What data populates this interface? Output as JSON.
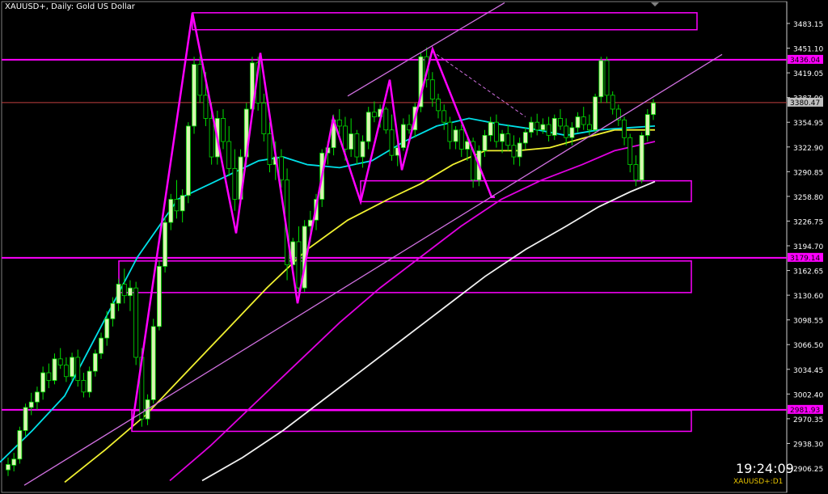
{
  "title": "XAUUSD+, Daily:  Gold US Dollar",
  "clock": "19:24:09",
  "symbol_tf": "XAUUSD+:D1",
  "colors": {
    "background": "#000000",
    "axis": "#ffffff",
    "bull_candle": "#d9f5b2",
    "bear_candle": "#000000",
    "wick": "#00e000",
    "magenta": "#ff00ff",
    "light_magenta": "#d070e0",
    "price_line": "#c04040",
    "ma_cyan": "#00e0e8",
    "ma_yellow": "#f0f030",
    "ma_magenta": "#e000e0",
    "ma_white": "#f0f0f0",
    "label_magenta_bg": "#ff00ff",
    "label_price_bg": "#c0c0c0"
  },
  "chart_data": {
    "type": "candlestick",
    "y_range": [
      2890,
      3500
    ],
    "y_ticks": [
      "3483.15",
      "3451.10",
      "3419.05",
      "3387.00",
      "3354.95",
      "3322.90",
      "3290.85",
      "3258.80",
      "3226.75",
      "3194.70",
      "3162.65",
      "3130.60",
      "3098.55",
      "3066.50",
      "3034.45",
      "3002.40",
      "2970.35",
      "2938.30",
      "2906.25"
    ],
    "price_labels": [
      {
        "text": "3436.04",
        "value": 3436.04,
        "style": "magenta"
      },
      {
        "text": "3380.47",
        "value": 3380.47,
        "style": "price"
      },
      {
        "text": "3179.14",
        "value": 3179.14,
        "style": "magenta"
      },
      {
        "text": "2981.93",
        "value": 2981.93,
        "style": "magenta"
      }
    ],
    "horizontal_lines": [
      {
        "value": 3436.04,
        "color": "magenta"
      },
      {
        "value": 3380.47,
        "color": "price"
      },
      {
        "value": 3179.14,
        "color": "magenta"
      },
      {
        "value": 2981.93,
        "color": "magenta"
      }
    ],
    "candles": [
      [
        2904,
        2920,
        2896,
        2911
      ],
      [
        2910,
        2926,
        2902,
        2918
      ],
      [
        2918,
        2960,
        2912,
        2955
      ],
      [
        2955,
        2990,
        2948,
        2985
      ],
      [
        2985,
        3004,
        2975,
        2992
      ],
      [
        2992,
        3012,
        2982,
        3005
      ],
      [
        3005,
        3038,
        2995,
        3030
      ],
      [
        3030,
        3042,
        3010,
        3020
      ],
      [
        3020,
        3055,
        3015,
        3048
      ],
      [
        3048,
        3062,
        3035,
        3040
      ],
      [
        3040,
        3050,
        3018,
        3025
      ],
      [
        3025,
        3056,
        3020,
        3050
      ],
      [
        3050,
        3060,
        3012,
        3020
      ],
      [
        3020,
        3030,
        2998,
        3005
      ],
      [
        3005,
        3038,
        2998,
        3032
      ],
      [
        3032,
        3060,
        3025,
        3055
      ],
      [
        3055,
        3082,
        3048,
        3075
      ],
      [
        3075,
        3110,
        3065,
        3100
      ],
      [
        3100,
        3128,
        3090,
        3120
      ],
      [
        3120,
        3152,
        3110,
        3145
      ],
      [
        3145,
        3165,
        3120,
        3130
      ],
      [
        3130,
        3150,
        3110,
        3140
      ],
      [
        3140,
        3148,
        3040,
        3050
      ],
      [
        3050,
        3062,
        2960,
        2970
      ],
      [
        2970,
        3002,
        2962,
        2995
      ],
      [
        2995,
        3100,
        2990,
        3090
      ],
      [
        3090,
        3175,
        3085,
        3168
      ],
      [
        3168,
        3232,
        3160,
        3225
      ],
      [
        3225,
        3262,
        3215,
        3255
      ],
      [
        3255,
        3280,
        3230,
        3240
      ],
      [
        3240,
        3268,
        3225,
        3260
      ],
      [
        3260,
        3355,
        3250,
        3350
      ],
      [
        3350,
        3440,
        3340,
        3430
      ],
      [
        3430,
        3440,
        3380,
        3390
      ],
      [
        3390,
        3420,
        3350,
        3360
      ],
      [
        3360,
        3380,
        3300,
        3310
      ],
      [
        3310,
        3370,
        3300,
        3360
      ],
      [
        3360,
        3372,
        3320,
        3330
      ],
      [
        3330,
        3350,
        3285,
        3295
      ],
      [
        3295,
        3320,
        3240,
        3255
      ],
      [
        3255,
        3320,
        3248,
        3310
      ],
      [
        3310,
        3380,
        3300,
        3372
      ],
      [
        3372,
        3440,
        3365,
        3432
      ],
      [
        3432,
        3440,
        3370,
        3380
      ],
      [
        3380,
        3392,
        3330,
        3340
      ],
      [
        3340,
        3355,
        3290,
        3300
      ],
      [
        3300,
        3330,
        3280,
        3310
      ],
      [
        3310,
        3320,
        3270,
        3280
      ],
      [
        3280,
        3295,
        3150,
        3170
      ],
      [
        3170,
        3205,
        3160,
        3200
      ],
      [
        3200,
        3220,
        3130,
        3140
      ],
      [
        3140,
        3228,
        3135,
        3220
      ],
      [
        3220,
        3240,
        3200,
        3228
      ],
      [
        3228,
        3262,
        3215,
        3255
      ],
      [
        3255,
        3320,
        3245,
        3315
      ],
      [
        3315,
        3330,
        3300,
        3322
      ],
      [
        3322,
        3365,
        3312,
        3358
      ],
      [
        3358,
        3372,
        3340,
        3350
      ],
      [
        3350,
        3362,
        3305,
        3320
      ],
      [
        3320,
        3360,
        3310,
        3340
      ],
      [
        3340,
        3345,
        3300,
        3310
      ],
      [
        3310,
        3338,
        3296,
        3330
      ],
      [
        3330,
        3375,
        3320,
        3368
      ],
      [
        3368,
        3382,
        3355,
        3362
      ],
      [
        3362,
        3378,
        3348,
        3372
      ],
      [
        3372,
        3375,
        3340,
        3345
      ],
      [
        3345,
        3365,
        3305,
        3312
      ],
      [
        3312,
        3330,
        3298,
        3322
      ],
      [
        3322,
        3360,
        3318,
        3352
      ],
      [
        3352,
        3365,
        3340,
        3345
      ],
      [
        3345,
        3380,
        3335,
        3375
      ],
      [
        3375,
        3445,
        3368,
        3440
      ],
      [
        3440,
        3452,
        3400,
        3410
      ],
      [
        3410,
        3420,
        3375,
        3385
      ],
      [
        3385,
        3392,
        3360,
        3370
      ],
      [
        3370,
        3378,
        3345,
        3355
      ],
      [
        3355,
        3362,
        3320,
        3330
      ],
      [
        3330,
        3350,
        3320,
        3345
      ],
      [
        3345,
        3352,
        3310,
        3320
      ],
      [
        3320,
        3338,
        3305,
        3330
      ],
      [
        3330,
        3335,
        3270,
        3280
      ],
      [
        3280,
        3325,
        3272,
        3318
      ],
      [
        3318,
        3345,
        3310,
        3338
      ],
      [
        3338,
        3362,
        3330,
        3355
      ],
      [
        3355,
        3365,
        3322,
        3330
      ],
      [
        3330,
        3345,
        3315,
        3340
      ],
      [
        3340,
        3352,
        3318,
        3325
      ],
      [
        3325,
        3338,
        3300,
        3310
      ],
      [
        3310,
        3335,
        3298,
        3328
      ],
      [
        3328,
        3348,
        3320,
        3342
      ],
      [
        3342,
        3362,
        3335,
        3355
      ],
      [
        3355,
        3366,
        3338,
        3345
      ],
      [
        3345,
        3360,
        3340,
        3352
      ],
      [
        3352,
        3362,
        3330,
        3338
      ],
      [
        3338,
        3365,
        3332,
        3360
      ],
      [
        3360,
        3372,
        3345,
        3350
      ],
      [
        3350,
        3360,
        3325,
        3335
      ],
      [
        3335,
        3355,
        3325,
        3348
      ],
      [
        3348,
        3368,
        3342,
        3362
      ],
      [
        3362,
        3375,
        3345,
        3352
      ],
      [
        3352,
        3365,
        3338,
        3345
      ],
      [
        3345,
        3392,
        3340,
        3388
      ],
      [
        3388,
        3440,
        3380,
        3435
      ],
      [
        3435,
        3440,
        3380,
        3390
      ],
      [
        3390,
        3395,
        3365,
        3372
      ],
      [
        3372,
        3378,
        3350,
        3358
      ],
      [
        3358,
        3362,
        3325,
        3335
      ],
      [
        3335,
        3340,
        3290,
        3300
      ],
      [
        3300,
        3312,
        3272,
        3280
      ],
      [
        3280,
        3342,
        3276,
        3338
      ],
      [
        3338,
        3372,
        3330,
        3365
      ],
      [
        3365,
        3385,
        3358,
        3380
      ]
    ],
    "ma_cyan": [
      [
        0,
        2914
      ],
      [
        40,
        2955
      ],
      [
        80,
        3000
      ],
      [
        120,
        3080
      ],
      [
        170,
        3180
      ],
      [
        220,
        3255
      ],
      [
        260,
        3275
      ],
      [
        290,
        3290
      ],
      [
        320,
        3305
      ],
      [
        350,
        3310
      ],
      [
        380,
        3300
      ],
      [
        420,
        3296
      ],
      [
        460,
        3305
      ],
      [
        500,
        3330
      ],
      [
        540,
        3350
      ],
      [
        580,
        3360
      ],
      [
        620,
        3352
      ],
      [
        660,
        3346
      ],
      [
        700,
        3338
      ],
      [
        740,
        3345
      ],
      [
        780,
        3348
      ],
      [
        810,
        3350
      ]
    ],
    "ma_yellow": [
      [
        80,
        2888
      ],
      [
        130,
        2930
      ],
      [
        180,
        2975
      ],
      [
        230,
        3030
      ],
      [
        280,
        3085
      ],
      [
        330,
        3140
      ],
      [
        380,
        3190
      ],
      [
        430,
        3228
      ],
      [
        480,
        3255
      ],
      [
        520,
        3275
      ],
      [
        560,
        3300
      ],
      [
        600,
        3318
      ],
      [
        640,
        3318
      ],
      [
        680,
        3322
      ],
      [
        720,
        3334
      ],
      [
        760,
        3345
      ],
      [
        810,
        3345
      ]
    ],
    "ma_magenta": [
      [
        210,
        2890
      ],
      [
        260,
        2935
      ],
      [
        320,
        2995
      ],
      [
        370,
        3045
      ],
      [
        420,
        3095
      ],
      [
        470,
        3140
      ],
      [
        520,
        3180
      ],
      [
        570,
        3220
      ],
      [
        620,
        3255
      ],
      [
        670,
        3280
      ],
      [
        720,
        3300
      ],
      [
        760,
        3318
      ],
      [
        810,
        3330
      ]
    ],
    "ma_white": [
      [
        250,
        2890
      ],
      [
        300,
        2920
      ],
      [
        350,
        2955
      ],
      [
        400,
        2995
      ],
      [
        450,
        3035
      ],
      [
        500,
        3075
      ],
      [
        550,
        3115
      ],
      [
        600,
        3155
      ],
      [
        650,
        3190
      ],
      [
        700,
        3220
      ],
      [
        740,
        3245
      ],
      [
        780,
        3265
      ],
      [
        810,
        3278
      ]
    ],
    "zigzag": [
      [
        163,
        2958
      ],
      [
        238,
        3497
      ],
      [
        292,
        3211
      ],
      [
        322,
        3445
      ],
      [
        368,
        3120
      ],
      [
        412,
        3360
      ],
      [
        446,
        3252
      ],
      [
        482,
        3410
      ],
      [
        497,
        3293
      ],
      [
        535,
        3450
      ],
      [
        608,
        3258
      ],
      [
        612,
        3258
      ]
    ],
    "channel": [
      {
        "from": [
          30,
          2884
        ],
        "to": [
          893,
          3443
        ],
        "color": "light_magenta"
      },
      {
        "from": [
          430,
          3389
        ],
        "to": [
          624,
          3510
        ],
        "color": "light_magenta"
      }
    ],
    "dashed_line": {
      "from": [
        540,
        3443
      ],
      "to": [
        650,
        3362
      ]
    },
    "rectangles": [
      {
        "x1": 238,
        "y1": 3497,
        "x2": 862,
        "y2": 3475
      },
      {
        "x1": 446,
        "y1": 3279,
        "x2": 855,
        "y2": 3252
      },
      {
        "x1": 147,
        "y1": 3175,
        "x2": 855,
        "y2": 3134
      },
      {
        "x1": 163,
        "y1": 2981,
        "x2": 855,
        "y2": 2954
      }
    ]
  }
}
